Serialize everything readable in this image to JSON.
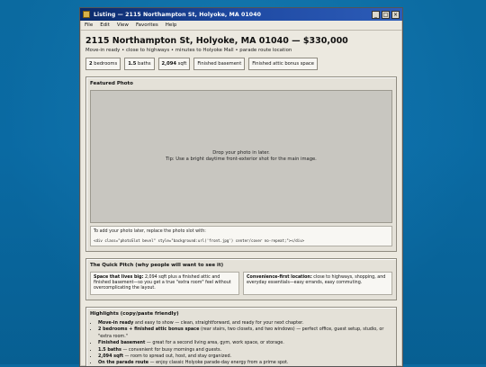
{
  "window": {
    "title": "Listing — 2115 Northampton St, Holyoke, MA 01040",
    "minimize": "_",
    "maximize": "□",
    "close": "×"
  },
  "menu": [
    "File",
    "Edit",
    "View",
    "Favorites",
    "Help"
  ],
  "listing": {
    "heading": "2115 Northampton St, Holyoke, MA 01040 — $330,000",
    "subline": "Move-in ready • close to highways • minutes to Holyoke Mall • parade route location"
  },
  "chips": [
    {
      "strong": "2",
      "rest": " bedrooms"
    },
    {
      "strong": "1.5",
      "rest": " baths"
    },
    {
      "strong": "2,094",
      "rest": " sqft"
    },
    {
      "strong": "",
      "rest": "Finished basement"
    },
    {
      "strong": "",
      "rest": "Finished attic bonus space"
    }
  ],
  "featured": {
    "title": "Featured Photo",
    "drop_text": "Drop your photo in later.",
    "tip_text": "Tip: Use a bright daytime front-exterior shot for the main image.",
    "code_intro": "To add your photo later, replace the photo slot with:",
    "code_snippet": "<div class=\"photoSlot bevel\" style=\"background:url('front.jpg') center/cover no-repeat;\"></div>"
  },
  "pitch": {
    "title": "The Quick Pitch (why people will want to see it)",
    "cards": [
      {
        "strong": "Space that lives big:",
        "rest": " 2,094 sqft plus a finished attic and finished basement—so you get a true \"extra room\" feel without overcomplicating the layout."
      },
      {
        "strong": "Convenience-first location:",
        "rest": " close to highways, shopping, and everyday essentials—easy errands, easy commuting."
      }
    ]
  },
  "highlights": {
    "title": "Highlights (copy/paste friendly)",
    "items": [
      {
        "strong": "Move-in ready",
        "rest": " and easy to show — clean, straightforward, and ready for your next chapter."
      },
      {
        "strong": "2 bedrooms + finished attic bonus space",
        "rest": " (rear stairs, two closets, and two windows) — perfect office, guest setup, studio, or \"extra room.\""
      },
      {
        "strong": "Finished basement",
        "rest": " — great for a second living area, gym, work space, or storage."
      },
      {
        "strong": "1.5 baths",
        "rest": " — convenient for busy mornings and guests."
      },
      {
        "strong": "2,094 sqft",
        "rest": " — room to spread out, host, and stay organized."
      },
      {
        "strong": "On the parade route",
        "rest": " — enjoy classic Holyoke parade-day energy from a prime spot."
      }
    ]
  },
  "colors": {
    "desktop": "#0a6aa3",
    "titlebar": "#0a2a6b",
    "window_bg": "#ece9e0"
  }
}
